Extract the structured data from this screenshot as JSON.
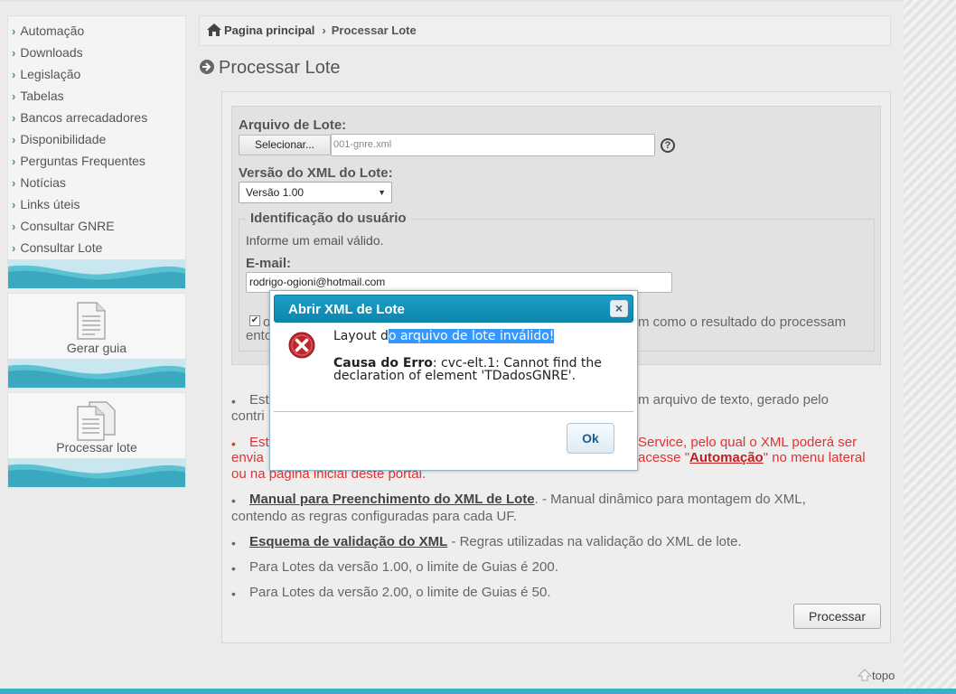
{
  "sidebar": {
    "menu": [
      {
        "label": "Automação"
      },
      {
        "label": "Downloads"
      },
      {
        "label": "Legislação"
      },
      {
        "label": "Tabelas"
      },
      {
        "label": "Bancos arrecadadores"
      },
      {
        "label": "Disponibilidade"
      },
      {
        "label": "Perguntas Frequentes"
      },
      {
        "label": "Notícias"
      },
      {
        "label": "Links úteis"
      },
      {
        "label": "Consultar GNRE"
      },
      {
        "label": "Consultar Lote"
      }
    ],
    "cards": [
      {
        "label": "Gerar guia",
        "icon": "document-icon"
      },
      {
        "label": "Processar lote",
        "icon": "documents-icon"
      }
    ],
    "chevron": "›",
    "accent": "#2a9bb5"
  },
  "breadcrumb": {
    "home": "Pagina principal",
    "separator": "›",
    "current": "Processar Lote"
  },
  "page": {
    "title": "Processar Lote"
  },
  "form": {
    "file_label": "Arquivo de Lote:",
    "select_button": "Selecionar...",
    "file_value": "001-gnre.xml",
    "help": "?",
    "version_label": "Versão do XML do Lote:",
    "version_value": "Versão 1.00",
    "user_legend": "Identificação do usuário",
    "user_info": "Informe um email válido.",
    "email_label": "E-mail:",
    "email_value": "rodrigo-ogioni@hotmail.com",
    "checkbox_checked": true,
    "checkbox_text_right": "m como o resultado do processam",
    "checkbox_text_left": "o",
    "checkbox_text_line2": "ento"
  },
  "notes": {
    "note1_start": "Est",
    "note1_right": "m arquivo de texto, gerado pelo",
    "note1_line2": "contri",
    "note2_start": "Est",
    "note2_right": "Service, pelo qual o XML poderá ser",
    "note2_line2_left": "envia",
    "note2_line2_right_pre": "acesse \"",
    "note2_link": "Automação",
    "note2_line2_right_post": "\" no menu lateral",
    "note2_line3": "ou na pagina inicial deste portal.",
    "manual_link": "Manual para Preenchimento do XML de Lote",
    "manual_text": ". - Manual dinâmico para montagem do XML,",
    "manual_line2": "contendo as regras configuradas para cada UF.",
    "schema_link": "Esquema de validação do XML",
    "schema_text": " - Regras utilizadas na validação do XML de lote.",
    "limit_100": "Para Lotes da versão 1.00, o limite de Guias é 200.",
    "limit_200": "Para Lotes da versão 2.00, o limite de Guias é 50."
  },
  "actions": {
    "process_button": "Processar",
    "top_link": "topo"
  },
  "dialog": {
    "title": "Abrir XML de Lote",
    "close": "×",
    "message_pre": "Layout d",
    "message_highlight": "o arquivo de lote inválido!",
    "cause_label": "Causa do Erro",
    "cause_text": ": cvc-elt.1: Cannot find the declaration of element 'TDadosGNRE'.",
    "ok_button": "Ok",
    "icon": "error-icon"
  }
}
